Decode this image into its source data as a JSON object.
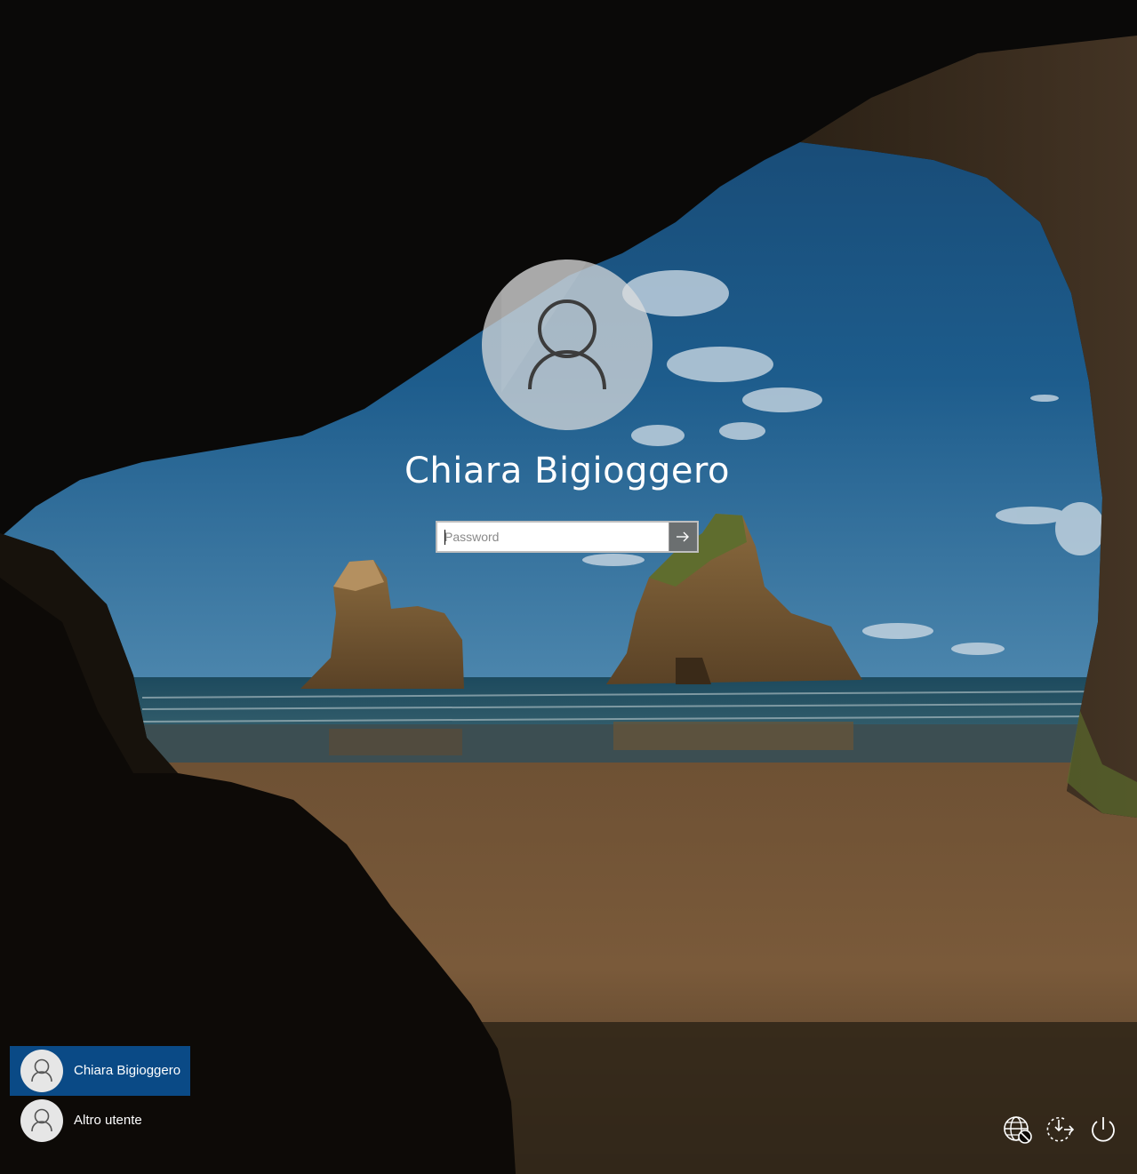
{
  "login": {
    "username": "Chiara Bigioggero",
    "password_placeholder": "Password",
    "submit_icon": "arrow-right-icon"
  },
  "user_switcher": {
    "users": [
      {
        "name": "Chiara Bigioggero",
        "selected": true,
        "icon": "user-icon"
      },
      {
        "name": "Altro utente",
        "selected": false,
        "icon": "user-icon"
      }
    ]
  },
  "tray": {
    "icons": [
      "network-disconnected-icon",
      "accessibility-icon",
      "power-icon"
    ]
  },
  "colors": {
    "selected_user_bg": "#0a4a86",
    "avatar_bg": "#dedede",
    "text": "#ffffff",
    "submit_bg": "#6b6f70"
  }
}
